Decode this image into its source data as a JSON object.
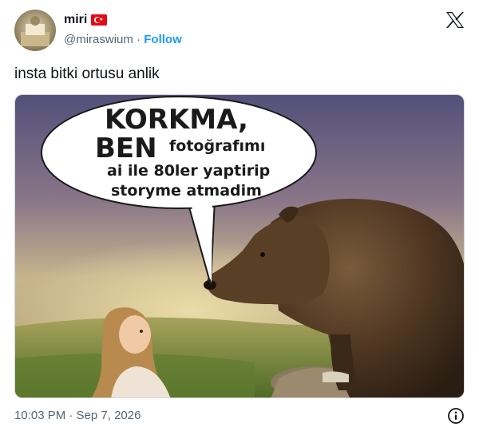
{
  "author": {
    "display_name": "miri",
    "handle": "@miraswium",
    "separator": "·",
    "follow_label": "Follow",
    "flag_icon": "turkey-flag-icon"
  },
  "brand_icon": "x-logo-icon",
  "tweet_text": "insta bitki ortusu anlik",
  "media": {
    "speech_bubble": {
      "line1": "KORKMA,",
      "line2_big": "BEN",
      "line2_small": "fotoğrafımı",
      "line3": "ai ile 80ler yaptirip",
      "line4": "storyme atmadim"
    }
  },
  "timestamp": "10:03 PM · Sep 7, 2026",
  "info_icon": "info-icon",
  "colors": {
    "follow": "#1d9bf0",
    "secondary_text": "#536471",
    "flag_red": "#e30a17"
  }
}
